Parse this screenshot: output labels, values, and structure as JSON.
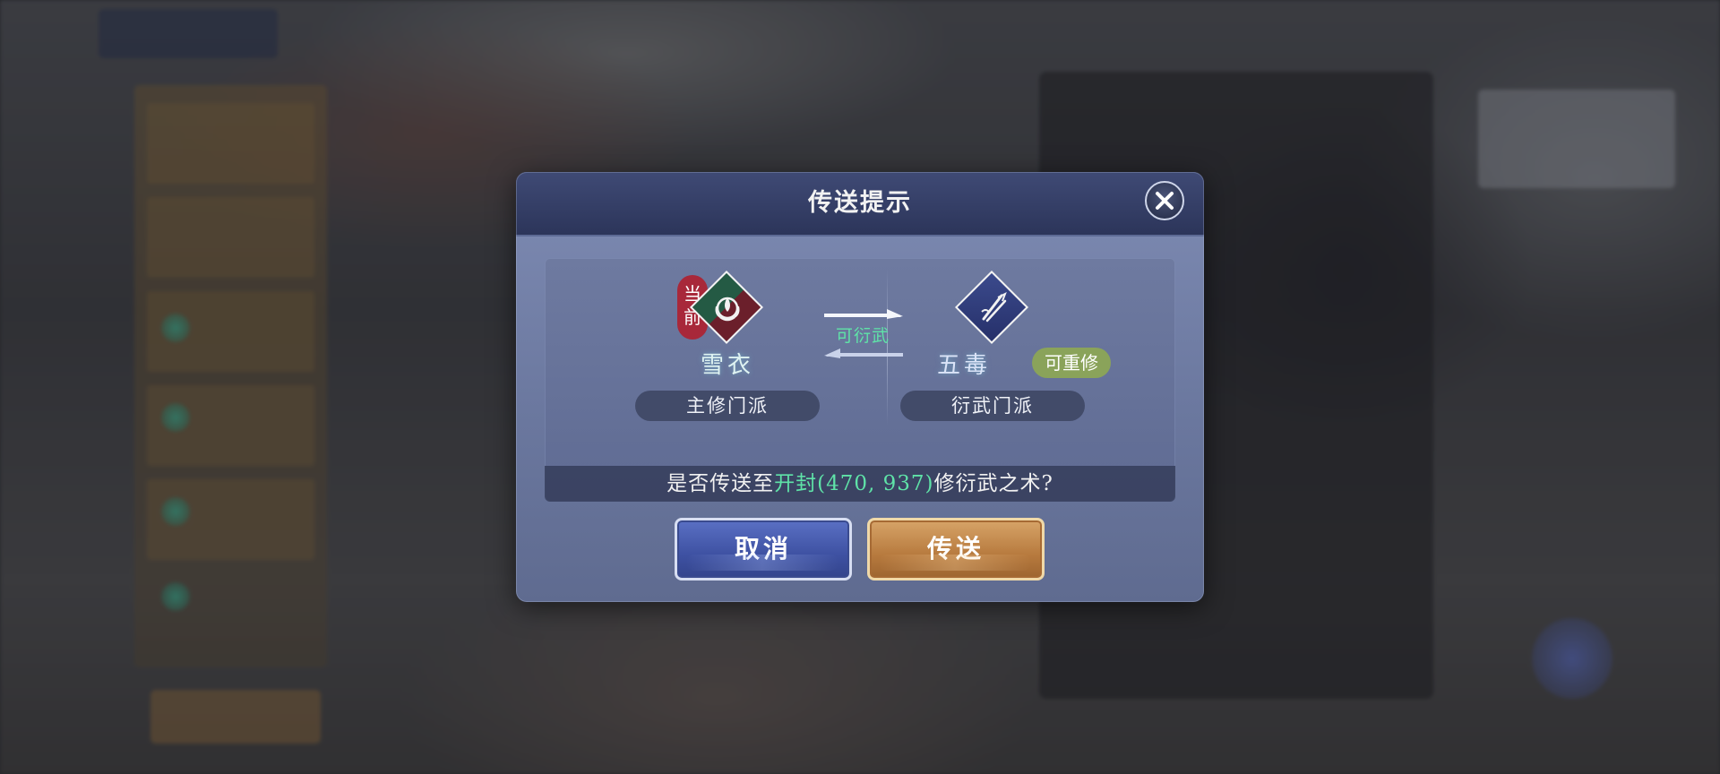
{
  "dialog": {
    "title": "传送提示",
    "current_badge": [
      "当",
      "前"
    ],
    "main_sect": {
      "name": "雪衣",
      "label": "主修门派"
    },
    "swap_label": "可衍武",
    "secondary_sect": {
      "name": "五毒",
      "tag": "可重修",
      "label": "衍武门派"
    },
    "question": {
      "prefix": "是否传送至",
      "destination": "开封(470, 937)",
      "suffix": "修衍武之术?"
    },
    "buttons": {
      "cancel": "取消",
      "confirm": "传送"
    }
  },
  "colors": {
    "accent_green": "#5fe3a8",
    "badge_red": "#a8283a",
    "tag_green": "#8aa35a",
    "cancel_blue": "#3e51a2",
    "confirm_gold": "#b77a3e"
  },
  "icons": {
    "close": "close-icon",
    "main_sect_emblem": "xueyi-sect-emblem-icon",
    "secondary_sect_emblem": "wudu-sect-emblem-icon",
    "swap": "swap-arrows-icon"
  }
}
